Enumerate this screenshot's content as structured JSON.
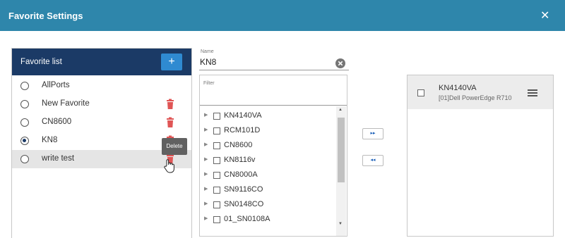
{
  "dialog": {
    "title": "Favorite Settings",
    "close_glyph": "✕"
  },
  "favorites": {
    "header_label": "Favorite list",
    "add_glyph": "+",
    "items": [
      {
        "label": "AllPorts",
        "checked": false,
        "deletable": false
      },
      {
        "label": "New Favorite",
        "checked": false,
        "deletable": true
      },
      {
        "label": "CN8600",
        "checked": false,
        "deletable": true
      },
      {
        "label": "KN8",
        "checked": true,
        "deletable": true
      },
      {
        "label": "write test",
        "checked": false,
        "deletable": true
      }
    ],
    "tooltip": "Delete"
  },
  "name_field": {
    "label": "Name",
    "value": "KN8"
  },
  "filter": {
    "label": "Filter",
    "placeholder": ""
  },
  "tree": {
    "items": [
      "KN4140VA",
      "RCM101D",
      "CN8600",
      "KN8116v",
      "CN8000A",
      "SN9116CO",
      "SN0148CO",
      "01_SN0108A"
    ]
  },
  "transfer": {
    "add_glyph": "▸▸",
    "remove_glyph": "◂◂"
  },
  "selected_ports": {
    "items": [
      {
        "name": "KN4140VA",
        "detail": "[01]Dell PowerEdge R710"
      }
    ]
  },
  "colors": {
    "title_bar": "#2e86ab",
    "list_header": "#1b3a66",
    "add_button": "#2f8ad1",
    "trash": "#e05555"
  }
}
